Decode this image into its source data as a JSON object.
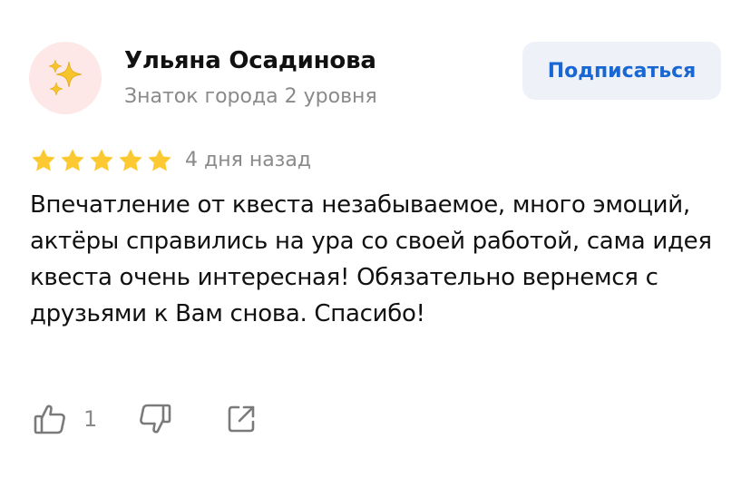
{
  "author": {
    "name": "Ульяна Осадинова",
    "level": "Знаток города 2 уровня",
    "avatar_icon": "sparkles-icon"
  },
  "subscribe": {
    "label": "Подписаться"
  },
  "review": {
    "rating": 5,
    "rating_max": 5,
    "date": "4 дня назад",
    "text": "Впечатление от квеста незабываемое, много эмоций, актёры справились на ура со своей работой, сама идея квеста очень интересная! Обязательно вернемся с друзьями к Вам снова. Спасибо!"
  },
  "actions": {
    "like_count": "1",
    "like_icon": "thumbs-up-icon",
    "dislike_icon": "thumbs-down-icon",
    "share_icon": "share-icon"
  },
  "colors": {
    "star": "#fcc933",
    "link": "#1967d2",
    "secondary_text": "#8a8a8a",
    "button_bg": "#eef2f8",
    "avatar_bg": "#fde7e7"
  }
}
